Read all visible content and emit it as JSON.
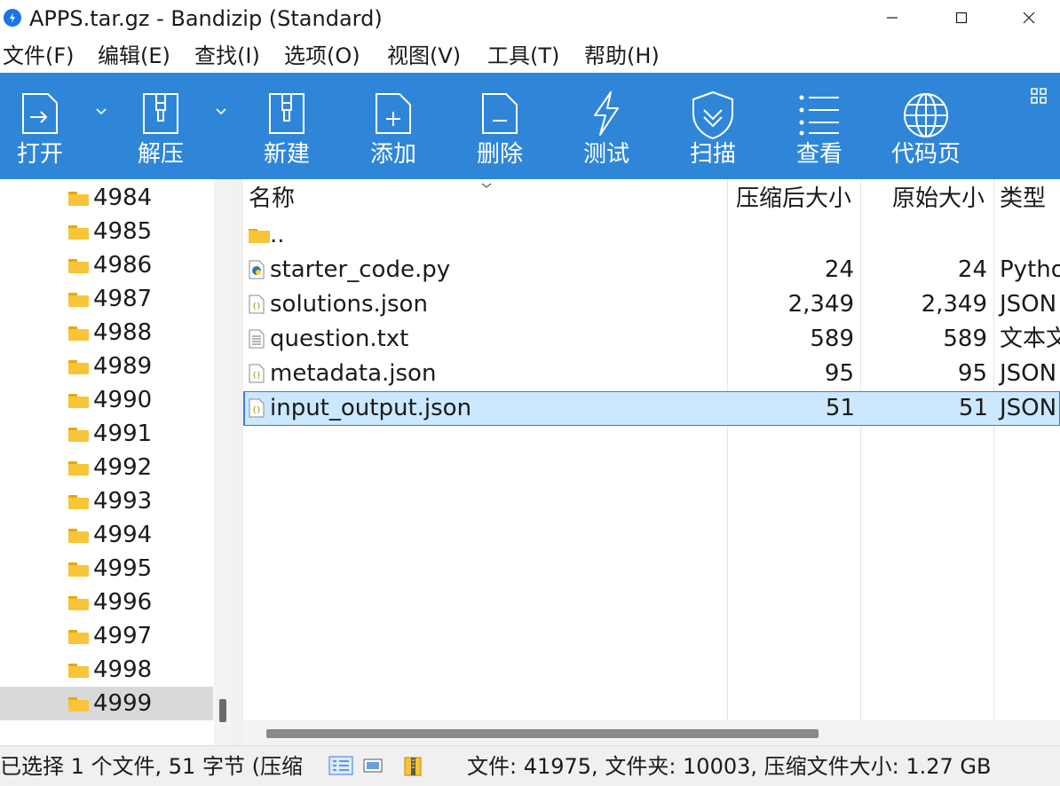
{
  "window": {
    "title": "APPS.tar.gz - Bandizip (Standard)"
  },
  "menu": [
    "文件(F)",
    "编辑(E)",
    "查找(I)",
    "选项(O)",
    "视图(V)",
    "工具(T)",
    "帮助(H)"
  ],
  "toolbar": {
    "open": "打开",
    "extract": "解压",
    "new": "新建",
    "add": "添加",
    "delete": "删除",
    "test": "测试",
    "scan": "扫描",
    "view": "查看",
    "codepage": "代码页"
  },
  "tree": {
    "items": [
      "4984",
      "4985",
      "4986",
      "4987",
      "4988",
      "4989",
      "4990",
      "4991",
      "4992",
      "4993",
      "4994",
      "4995",
      "4996",
      "4997",
      "4998",
      "4999"
    ],
    "selected": "4999"
  },
  "columns": {
    "name": "名称",
    "packed": "压缩后大小",
    "original": "原始大小",
    "type": "类型"
  },
  "files": [
    {
      "name": "..",
      "packed": "",
      "original": "",
      "type": "",
      "icon": "folder-icon"
    },
    {
      "name": "starter_code.py",
      "packed": "24",
      "original": "24",
      "type": "Pytho",
      "icon": "python-file-icon"
    },
    {
      "name": "solutions.json",
      "packed": "2,349",
      "original": "2,349",
      "type": "JSON",
      "icon": "json-file-icon"
    },
    {
      "name": "question.txt",
      "packed": "589",
      "original": "589",
      "type": "文本文",
      "icon": "text-file-icon"
    },
    {
      "name": "metadata.json",
      "packed": "95",
      "original": "95",
      "type": "JSON",
      "icon": "json-file-icon"
    },
    {
      "name": "input_output.json",
      "packed": "51",
      "original": "51",
      "type": "JSON",
      "icon": "json-file-icon"
    }
  ],
  "selected_file": "input_output.json",
  "status": {
    "selection": "已选择 1 个文件, 51 字节 (压缩",
    "summary": "文件: 41975, 文件夹: 10003, 压缩文件大小: 1.27 GB"
  },
  "colors": {
    "toolbar": "#2f86d8",
    "selection": "#cce8ff",
    "folder": "#f8c43a"
  }
}
